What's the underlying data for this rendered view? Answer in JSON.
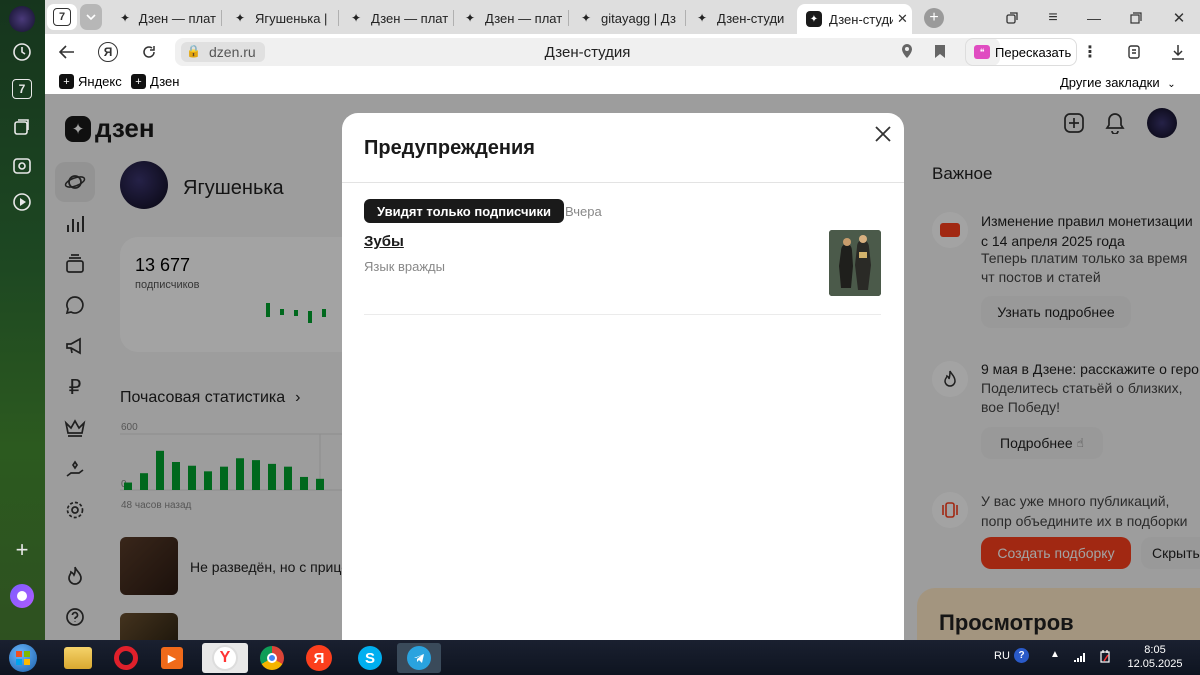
{
  "browser": {
    "tabs": [
      {
        "label": "Дзен — плат"
      },
      {
        "label": "Ягушенька |"
      },
      {
        "label": "Дзен — плат"
      },
      {
        "label": "Дзен — плат"
      },
      {
        "label": "gitayagg | Дз"
      },
      {
        "label": "Дзен-студи"
      },
      {
        "label": "Дзен-студи"
      }
    ],
    "tab_group_badge": "7",
    "address": "dzen.ru",
    "page_title": "Дзен-студия",
    "retell_label": "Пересказать",
    "bookmarks": [
      "Яндекс",
      "Дзен"
    ],
    "other_bookmarks": "Другие закладки"
  },
  "sidebar_badge": "7",
  "dzen": {
    "logo": "дзен",
    "channel_name": "Ягушенька",
    "subs_count": "13 677",
    "subs_label": "подписчиков",
    "hourly_title": "Почасовая статистика",
    "axis_max": "600",
    "axis_min": "0",
    "axis_caption": "48 часов назад",
    "pub1": "Не разведён, но с прице",
    "important_title": "Важное",
    "news": [
      {
        "title": "Изменение правил монетизации с 14 апреля 2025 года",
        "text": "Теперь платим только за время чт постов и статей",
        "button": "Узнать подробнее"
      },
      {
        "title": "9 мая в Дзене: расскажите о геро",
        "text": "Поделитесь статьёй о близких, вое Победу!",
        "button": "Подробнее"
      },
      {
        "title": "",
        "text": "У вас уже много публикаций, попр объедините их в подборки",
        "button": "Создать подборку",
        "button2": "Скрыть"
      }
    ],
    "views_title": "Просмотров"
  },
  "modal": {
    "title": "Предупреждения",
    "badge": "Увидят только подписчики",
    "date": "Вчера",
    "item_title": "Зубы",
    "item_reason": "Язык вражды"
  },
  "taskbar": {
    "lang": "RU",
    "time": "8:05",
    "date": "12.05.2025"
  },
  "colors": {
    "accent": "#fc3f1d",
    "bar_green": "#00a32e",
    "dark": "#1a1a1a"
  },
  "chart_data": {
    "type": "bar",
    "title": "Почасовая статистика",
    "xlabel": "48 часов назад",
    "ylim": [
      0,
      600
    ],
    "values": [
      80,
      180,
      420,
      300,
      260,
      200,
      250,
      340,
      320,
      280,
      250,
      140,
      120
    ],
    "series": [
      {
        "values": [
          80,
          180,
          420,
          300,
          260,
          200,
          250,
          340,
          320,
          280,
          250,
          140,
          120
        ]
      }
    ]
  }
}
